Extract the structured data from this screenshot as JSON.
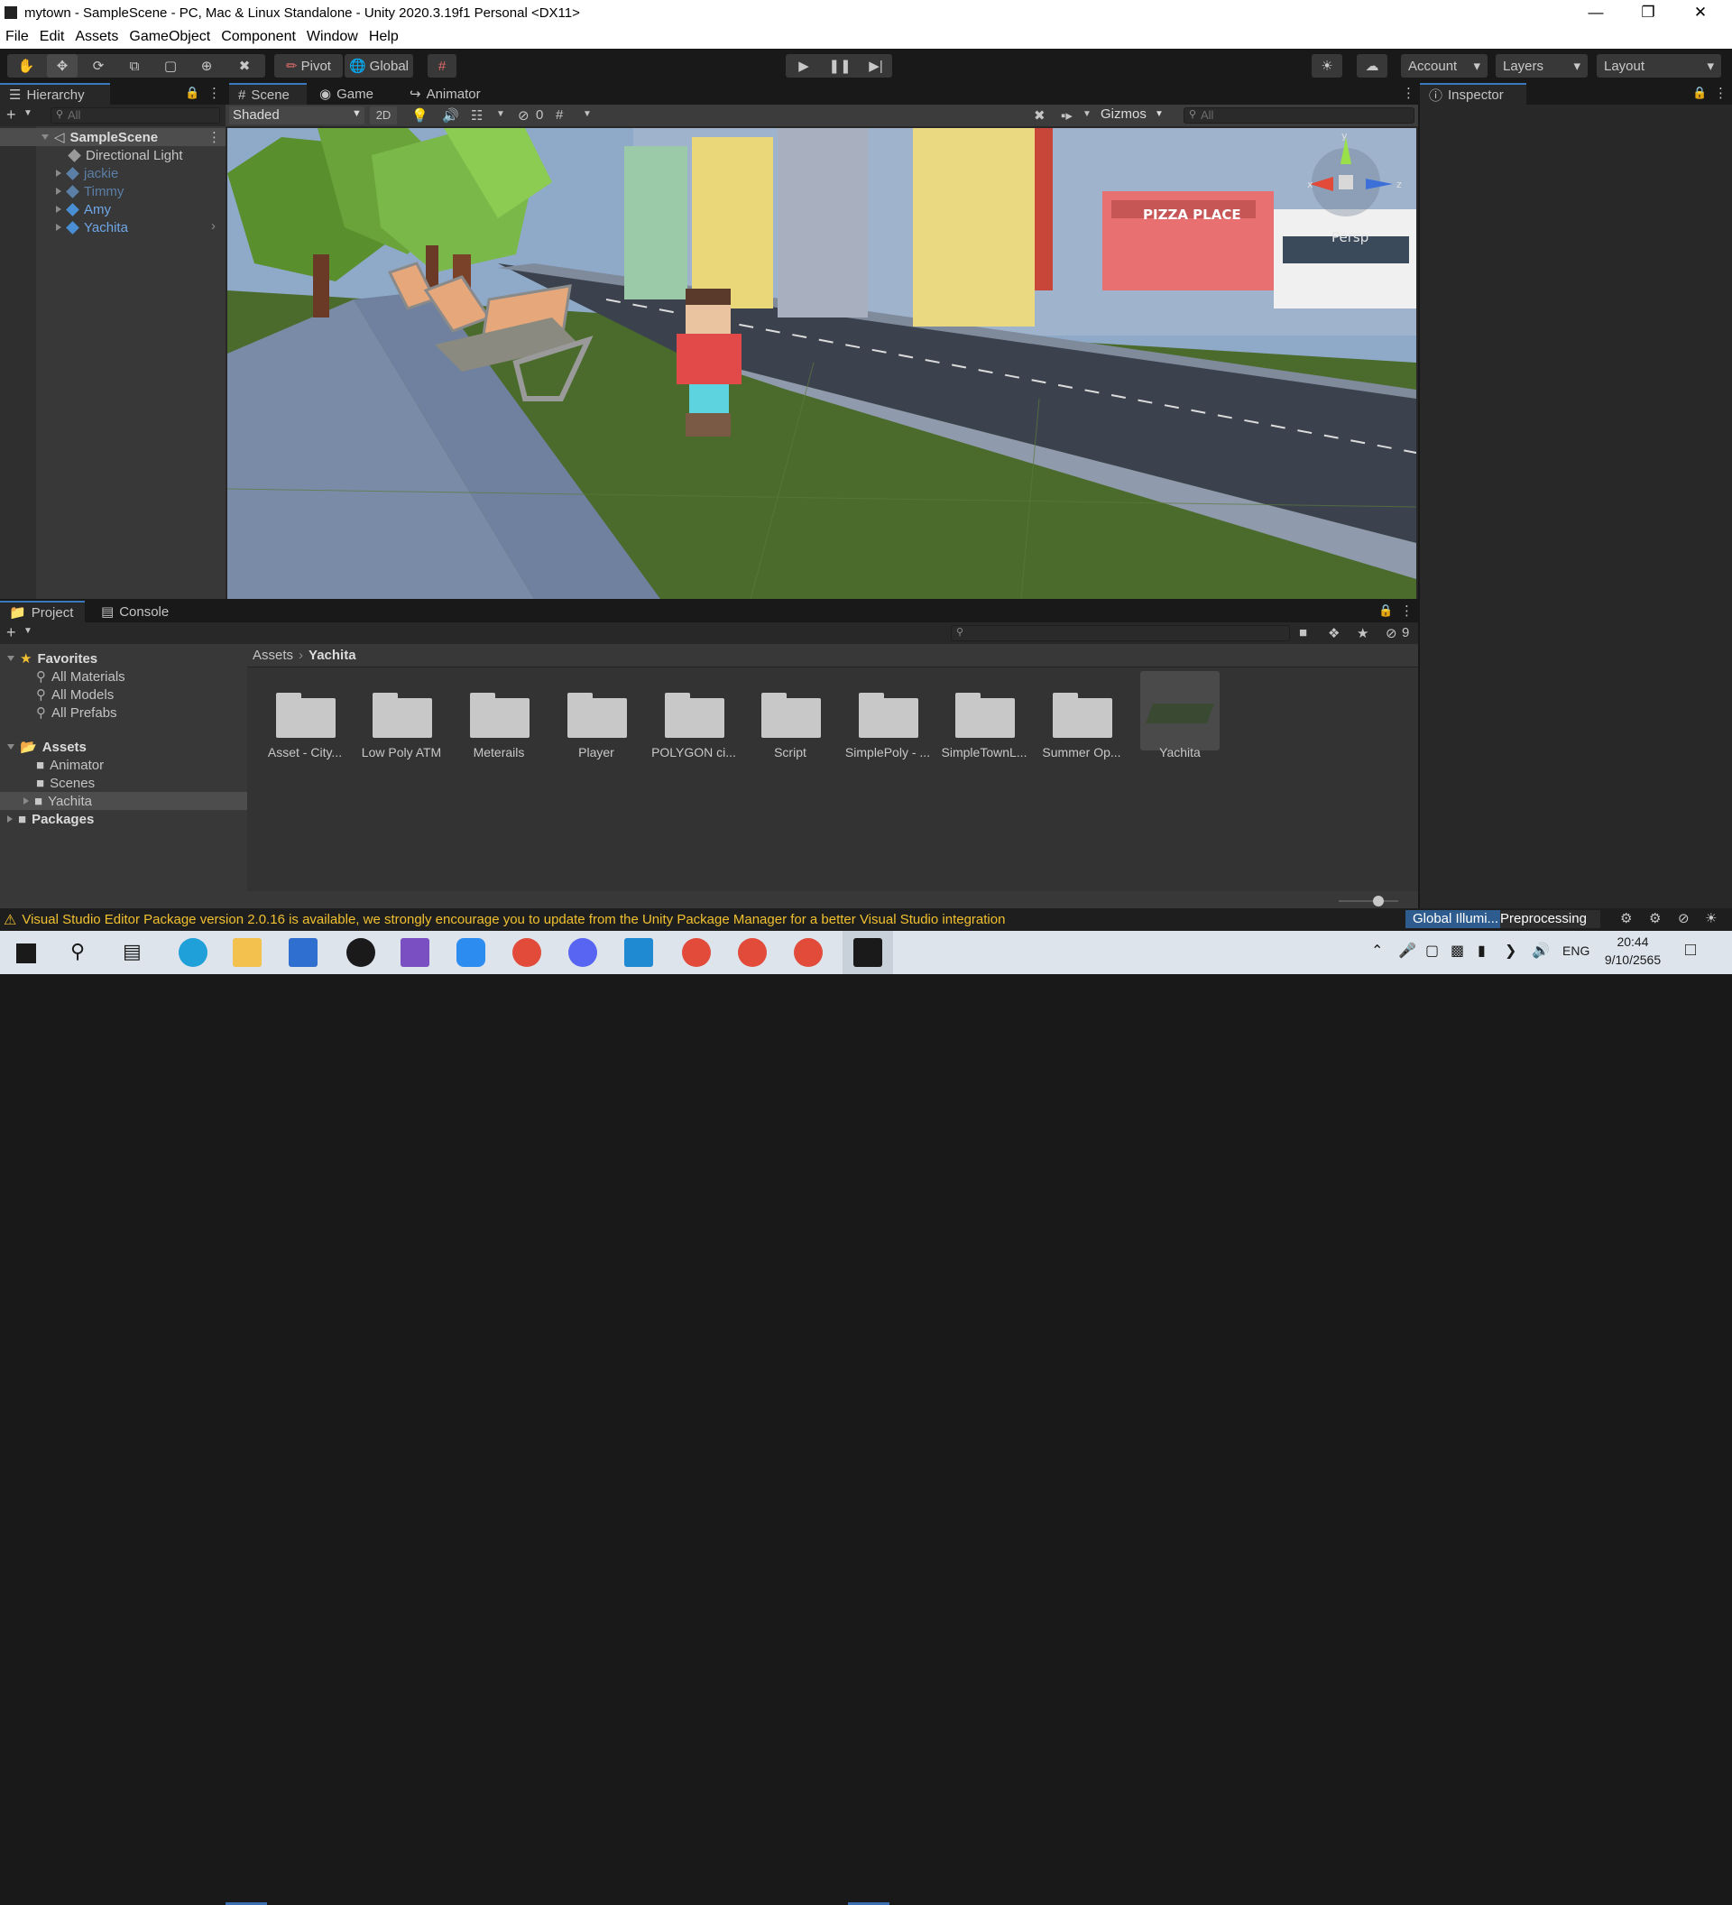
{
  "window": {
    "title": "mytown - SampleScene - PC, Mac & Linux Standalone - Unity 2020.3.19f1 Personal <DX11>"
  },
  "menu": [
    "File",
    "Edit",
    "Assets",
    "GameObject",
    "Component",
    "Window",
    "Help"
  ],
  "toolbar": {
    "pivot": "Pivot",
    "global": "Global",
    "account": "Account",
    "layers": "Layers",
    "layout": "Layout"
  },
  "hierarchy": {
    "tab": "Hierarchy",
    "search_placeholder": "All",
    "scene": "SampleScene",
    "items": [
      {
        "label": "Directional Light",
        "color": "#c4c4c4"
      },
      {
        "label": "jackie",
        "color": "#5b7fa6"
      },
      {
        "label": "Timmy",
        "color": "#5b7fa6"
      },
      {
        "label": "Amy",
        "color": "#6fa7e6"
      },
      {
        "label": "Yachita",
        "color": "#6fa7e6"
      }
    ]
  },
  "scene_view": {
    "tabs": [
      "Scene",
      "Game",
      "Animator"
    ],
    "shading": "Shaded",
    "mode_2d": "2D",
    "hidden_count": "0",
    "gizmos": "Gizmos",
    "search_placeholder": "All",
    "persp": "Persp",
    "sign": "PIZZA PLACE"
  },
  "inspector": {
    "tab": "Inspector"
  },
  "project": {
    "tabs": [
      "Project",
      "Console"
    ],
    "favorites": {
      "label": "Favorites",
      "items": [
        "All Materials",
        "All Models",
        "All Prefabs"
      ]
    },
    "assets": {
      "label": "Assets",
      "items": [
        "Animator",
        "Scenes",
        "Yachita"
      ]
    },
    "packages": "Packages",
    "breadcrumb": [
      "Assets",
      "Yachita"
    ],
    "hidden_count": "9",
    "folders": [
      "Asset - City...",
      "Low Poly ATM",
      "Meterails",
      "Player",
      "POLYGON ci...",
      "Script",
      "SimplePoly - ...",
      "SimpleTownL...",
      "Summer Op...",
      "Yachita"
    ]
  },
  "status": {
    "message": "Visual Studio Editor Package version 2.0.16 is available, we strongly encourage you to update from the Unity Package Manager for a better Visual Studio integration",
    "gi_label": "Global Illumi...",
    "gi_status": "Preprocessing"
  },
  "taskbar": {
    "lang": "ENG",
    "time": "20:44",
    "date": "9/10/2565"
  }
}
